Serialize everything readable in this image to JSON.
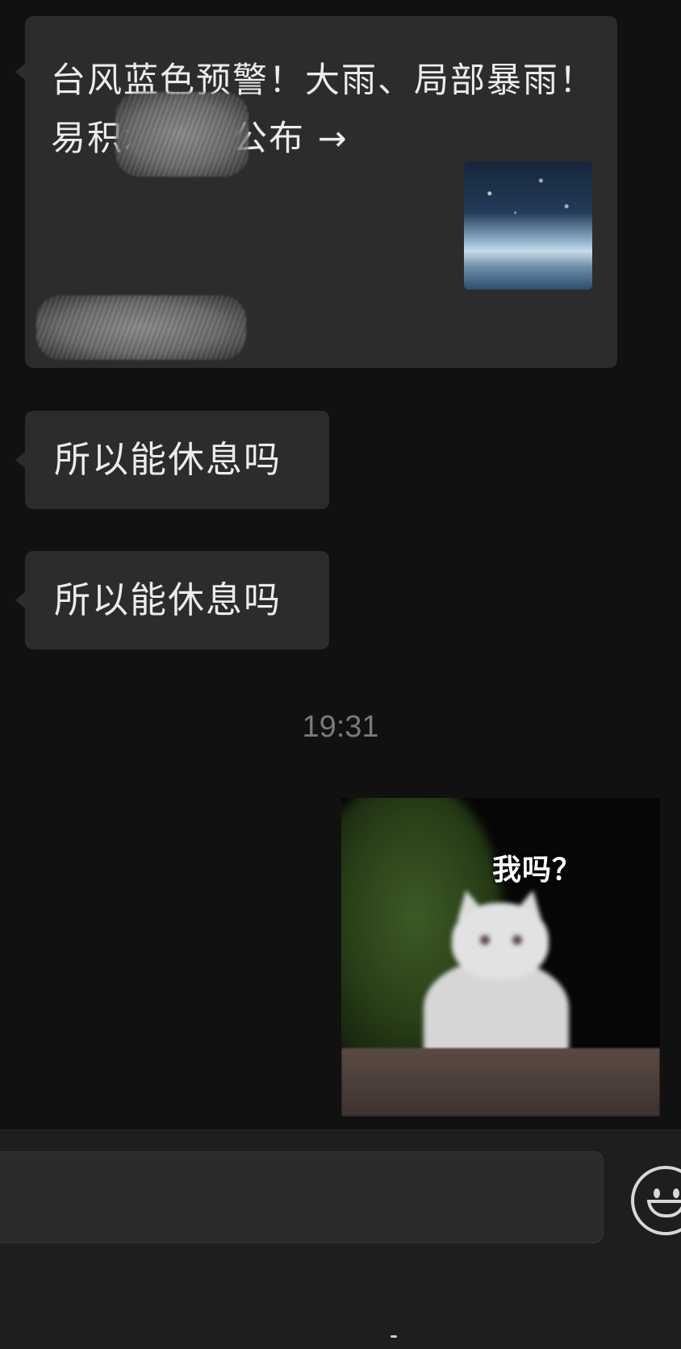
{
  "chat": {
    "link_card": {
      "title": "台风蓝色预警！大雨、局部暴雨！　　　易积水路段公布 →",
      "thumbnail_icon": "heavy-rain-image"
    },
    "messages": [
      {
        "text": "所以能休息吗"
      },
      {
        "text": "所以能休息吗"
      }
    ],
    "timestamp": "19:31",
    "sticker": {
      "caption": "我吗？",
      "image": "white-cat-sticker"
    }
  },
  "input_bar": {
    "value": "",
    "emoji_icon": "smiley-face-icon"
  },
  "colors": {
    "background": "#111111",
    "bubble": "#2c2c2c",
    "timestamp": "#7a7a7a"
  }
}
